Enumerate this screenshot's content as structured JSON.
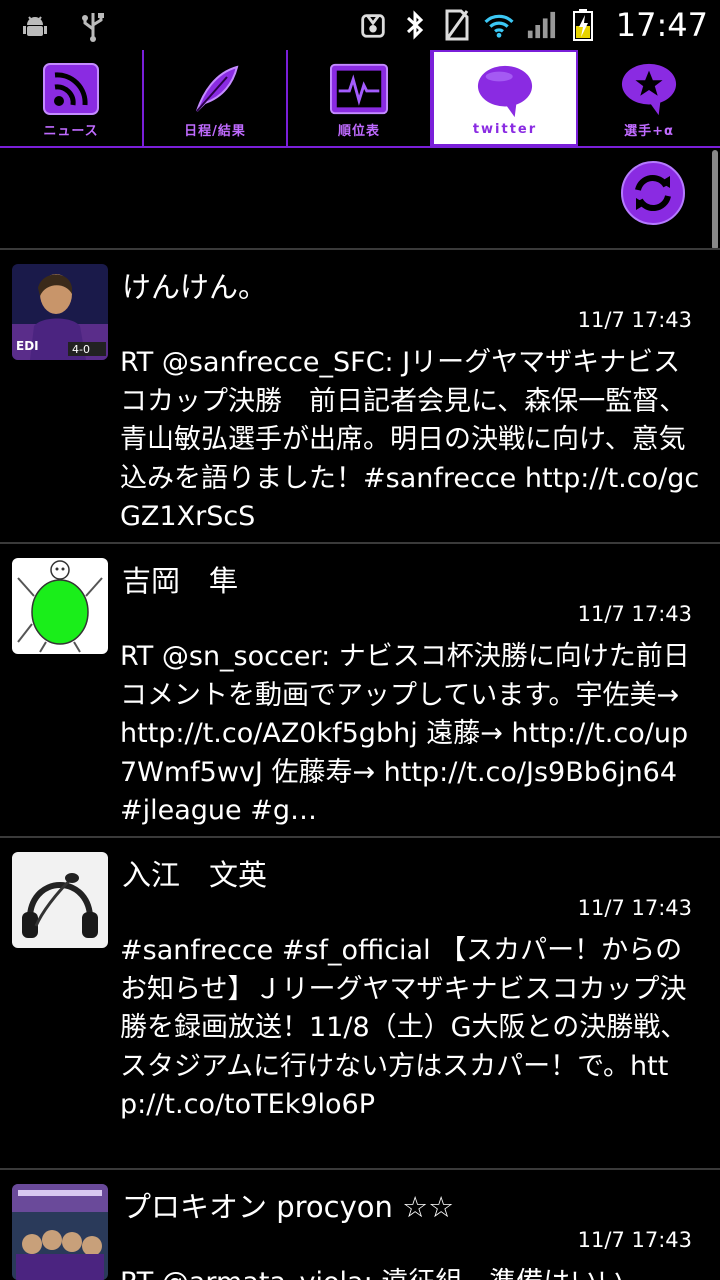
{
  "status_bar": {
    "time": "17:47"
  },
  "tabs": [
    {
      "label": "ニュース",
      "icon": "rss-icon"
    },
    {
      "label": "日程/結果",
      "icon": "feather-icon"
    },
    {
      "label": "順位表",
      "icon": "pulse-icon"
    },
    {
      "label": "twitter",
      "icon": "speech-bubble-icon",
      "active": true
    },
    {
      "label": "選手+α",
      "icon": "star-bubble-icon"
    }
  ],
  "colors": {
    "accent": "#7a1fd9",
    "background": "#000000",
    "text": "#ffffff"
  },
  "tweets": [
    {
      "name": "けんけん。",
      "time": "11/7 17:43",
      "text": "RT @sanfrecce_SFC: Jリーグヤマザキナビスコカップ決勝　前日記者会見に、森保一監督、青山敏弘選手が出席。明日の決戦に向け、意気込みを語りました！#sanfrecce http://t.co/gcGZ1XrScS",
      "score": "4-0"
    },
    {
      "name": "吉岡　隼",
      "time": "11/7 17:43",
      "text": "RT @sn_soccer: ナビスコ杯決勝に向けた前日コメントを動画でアップしています。宇佐美→ http://t.co/AZ0kf5gbhj 遠藤→ http://t.co/up7Wmf5wvJ 佐藤寿→ http://t.co/Js9Bb6jn64 #jleague #g…"
    },
    {
      "name": "入江　文英",
      "time": "11/7 17:43",
      "text": "#sanfrecce #sf_official 【スカパー！からのお知らせ】Ｊリーグヤマザキナビスコカップ決勝を録画放送！11/8（土）G大阪との決勝戦、スタジアムに行けない方はスカパー！で。http://t.co/toTEk9lo6P"
    },
    {
      "name": "プロキオン procyon ☆☆",
      "time": "11/7 17:43",
      "text": "RT @armata_viola: 遠征組、準備はいい"
    }
  ]
}
